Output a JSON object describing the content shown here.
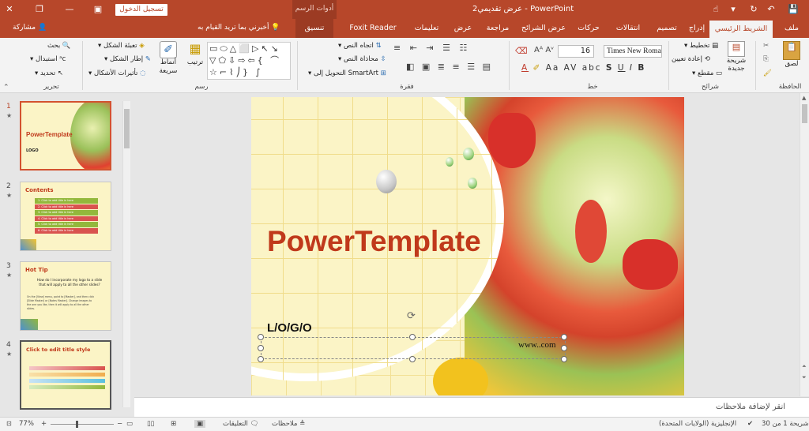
{
  "titlebar": {
    "title": "عرض تقديمي2 - PowerPoint",
    "login": "تسجيل الدخول",
    "tools_title": "أدوات الرسم"
  },
  "tabs": {
    "file": "ملف",
    "home": "الشريط الرئيسي",
    "insert": "إدراج",
    "design": "تصميم",
    "transitions": "انتقالات",
    "animations": "حركات",
    "slideshow": "عرض الشرائح",
    "review": "مراجعة",
    "view": "عرض",
    "help": "تعليمات",
    "foxit": "Foxit Reader PDF",
    "format": "تنسيق",
    "tellme": "أخبرني بما تريد القيام به",
    "share": "مشاركة"
  },
  "ribbon": {
    "clipboard": {
      "paste": "لصق",
      "label": "الحافظة"
    },
    "slides": {
      "new_slide": "شريحة جديدة",
      "layout": "تخطيط",
      "reset": "إعادة تعيين",
      "section": "مقطع",
      "label": "شرائح"
    },
    "font": {
      "name": "Times New Roma",
      "size": "16",
      "label": "خط",
      "bold": "B",
      "italic": "I",
      "underline": "U",
      "strike": "S",
      "shadow": "abc",
      "spacing": "AV",
      "case": "Aa"
    },
    "paragraph": {
      "direction": "اتجاه النص",
      "align": "محاذاة النص",
      "smartart": "التحويل إلى SmartArt",
      "label": "فقرة"
    },
    "drawing": {
      "arrange": "ترتيب",
      "quick_styles": "أنماط سريعة",
      "fill": "تعبئة الشكل",
      "outline": "إطار الشكل",
      "effects": "تأثيرات الأشكال",
      "label": "رسم"
    },
    "editing": {
      "find": "بحث",
      "replace": "استبدال",
      "select": "تحديد",
      "label": "تحرير"
    }
  },
  "thumbs": [
    {
      "num": "1",
      "title": "PowerTemplate",
      "logo": "LOGO"
    },
    {
      "num": "2",
      "title": "Contents",
      "rows": [
        "1. Click to add title in here",
        "2. Click to add title in here",
        "3. Click to add title in here",
        "4. Click to add title in here",
        "5. Click to add title in here",
        "6. Click to add title in here"
      ]
    },
    {
      "num": "3",
      "title": "Hot Tip",
      "line1": "How do I incorporate my logo to a slide",
      "line2": "that will apply to all the other slides?",
      "body1": "On the [View] menu, point to [Master], and then click",
      "body2": "[Slide Master] or [Notes Master]. Change images to",
      "body3": "the one you like, then it will apply to all the other",
      "body4": "slides."
    },
    {
      "num": "4",
      "title": "Click to edit title style"
    }
  ],
  "slide": {
    "title": "PowerTemplate",
    "logo": "L/O/G/O",
    "url": "www..com"
  },
  "notes": {
    "placeholder": "انقر لإضافة ملاحظات"
  },
  "status": {
    "slide_count": "شريحة 1 من 30",
    "language": "الإنجليزية (الولايات المتحدة)",
    "notes": "ملاحظات",
    "comments": "التعليقات",
    "zoom": "77%"
  },
  "colors": {
    "accent": "#b7472a",
    "title_red": "#c0391b"
  }
}
